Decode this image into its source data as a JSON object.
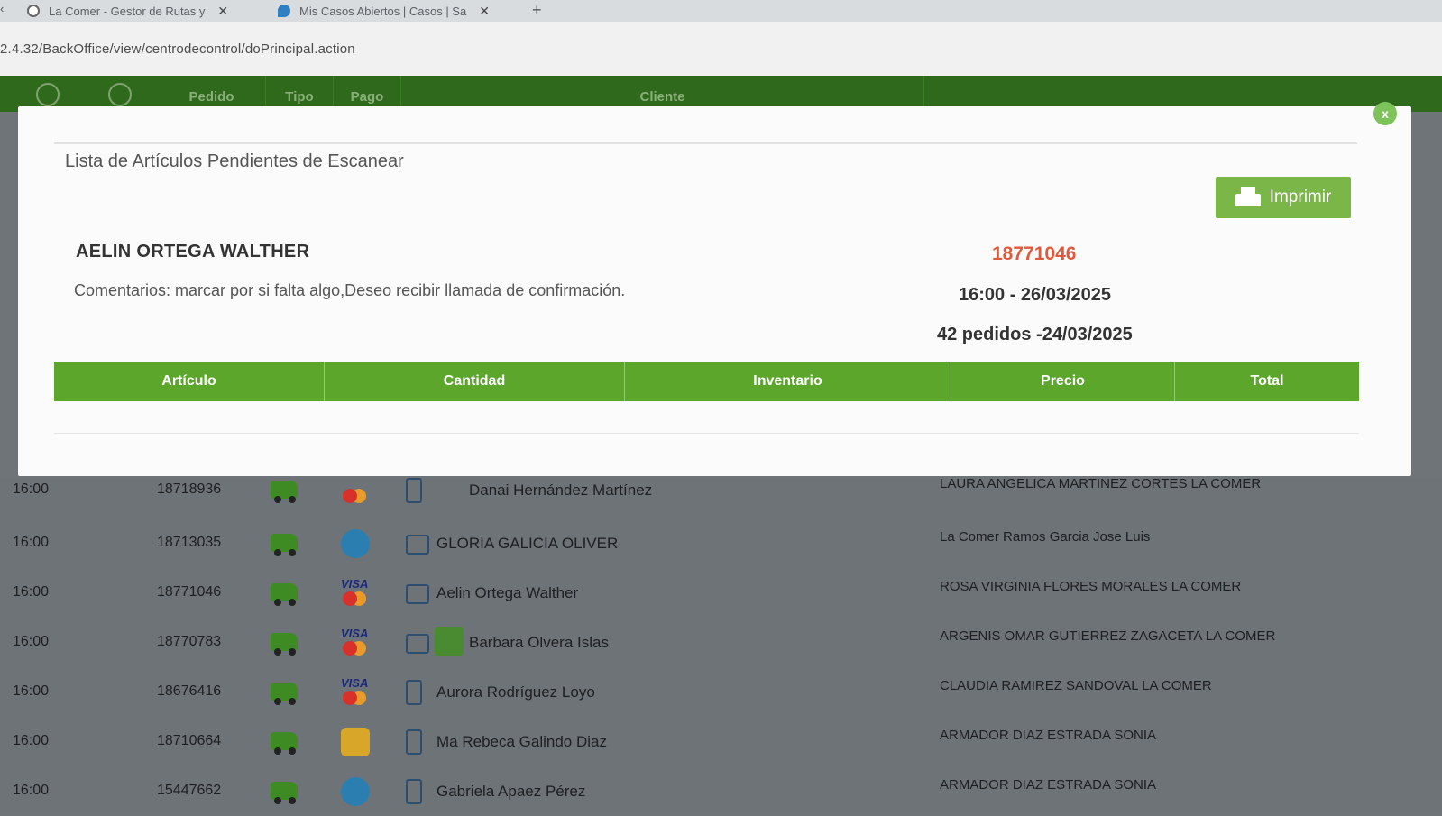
{
  "browser": {
    "tabs": [
      {
        "title": "La Comer - Gestor de Rutas y ",
        "icon": "globe-icon"
      },
      {
        "title": "Mis Casos Abiertos | Casos | Sa",
        "icon": "cloud-icon"
      }
    ],
    "new_tab": "+",
    "close": "✕",
    "url": "2.4.32/BackOffice/view/centrodecontrol/doPrincipal.action"
  },
  "app_header": {
    "columns": [
      "Pedido",
      "Tipo",
      "Pago",
      "Cliente"
    ]
  },
  "modal": {
    "title": "Lista de Artículos Pendientes de Escanear",
    "print_label": "Imprimir",
    "close_label": "x",
    "client_name": "AELIN ORTEGA WALTHER",
    "comments": "Comentarios: marcar por si falta algo,Deseo recibir llamada de confirmación.",
    "order_number": "18771046",
    "delivery": "16:00 - 26/03/2025",
    "orders_summary": "42 pedidos -24/03/2025",
    "table_headers": [
      "Artículo",
      "Cantidad",
      "Inventario",
      "Precio",
      "Total"
    ],
    "accent_color": "#5ca72b",
    "order_number_color": "#e2583a"
  },
  "orders": [
    {
      "time": "16:00",
      "number": "18718936",
      "payment": "visa",
      "device": "phone",
      "name": "Danai Hernández Martínez",
      "shopper": "LAURA ANGELICA MARTINEZ CORTES LA COMER"
    },
    {
      "time": "16:00",
      "number": "18713035",
      "payment": "card",
      "device": "screen",
      "name": "GLORIA GALICIA OLIVER",
      "shopper": "La Comer Ramos Garcia Jose Luis"
    },
    {
      "time": "16:00",
      "number": "18771046",
      "payment": "visa",
      "device": "screen",
      "name": "Aelin Ortega Walther",
      "shopper": "ROSA VIRGINIA FLORES MORALES LA COMER"
    },
    {
      "time": "16:00",
      "number": "18770783",
      "payment": "visa",
      "device": "screen",
      "name": "Barbara Olvera Islas",
      "shopper": "ARGENIS OMAR GUTIERREZ ZAGACETA LA COMER"
    },
    {
      "time": "16:00",
      "number": "18676416",
      "payment": "visa",
      "device": "phone",
      "name": "Aurora Rodríguez Loyo",
      "shopper": "CLAUDIA RAMIREZ SANDOVAL LA COMER"
    },
    {
      "time": "16:00",
      "number": "18710664",
      "payment": "coins",
      "device": "phone",
      "name": "Ma Rebeca Galindo Diaz",
      "shopper": "ARMADOR DIAZ ESTRADA SONIA"
    },
    {
      "time": "16:00",
      "number": "15447662",
      "payment": "card",
      "device": "phone",
      "name": "Gabriela Apaez Pérez",
      "shopper": "ARMADOR DIAZ ESTRADA SONIA"
    }
  ],
  "visa_text": "VISA"
}
